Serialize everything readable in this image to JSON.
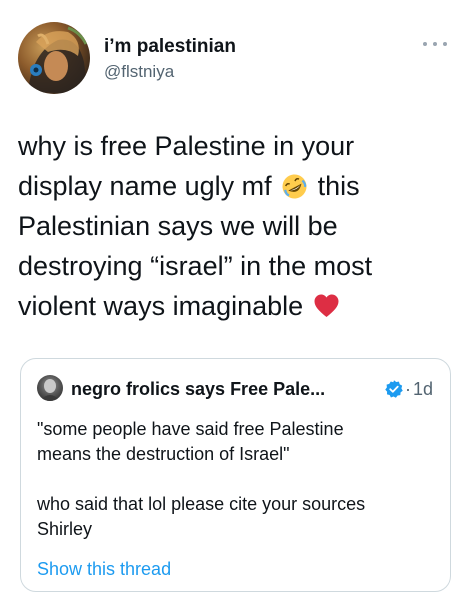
{
  "author": {
    "display_name": "i’m palestinian",
    "handle": "@flstniya",
    "avatar_icon": "profile-photo"
  },
  "more_icon": "more-horizontal-icon",
  "tweet": {
    "lines": [
      "why is free Palestine in your",
      "display name ugly mf",
      "this",
      "Palestinian says we will be",
      "destroying “israel” in the most",
      "violent ways imaginable"
    ],
    "emojis": [
      "rolling-on-floor-laughing-emoji",
      "red-heart-emoji"
    ]
  },
  "quote": {
    "author_name": "negro frolics says Free Pale...",
    "verified": true,
    "verified_color": "#1d9bf0",
    "separator": "·",
    "timestamp": "1d",
    "lines": [
      "\"some people have said free Palestine",
      "means the destruction of Israel\"",
      "",
      "who said that lol please cite your sources",
      "Shirley"
    ],
    "show_thread_label": "Show this thread",
    "link_color": "#1d9bf0"
  }
}
